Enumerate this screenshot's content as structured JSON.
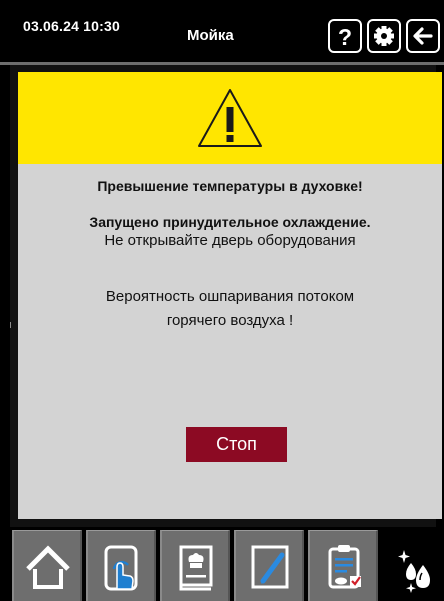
{
  "header": {
    "datetime": "03.06.24  10:30",
    "title": "Мойка",
    "buttons": [
      {
        "icon": "help-icon"
      },
      {
        "icon": "gear-icon"
      },
      {
        "icon": "back-arrow-icon"
      }
    ]
  },
  "alert": {
    "icon": "warning-triangle-icon",
    "header_color": "#ffe600",
    "line1": "Превышение температуры в духовке!",
    "line2": "Запущено принудительное охлаждение.",
    "line3": "Не открывайте дверь оборудования",
    "line4": "Вероятность ошпаривания потоком",
    "line5": "горячего воздуха !",
    "stop_label": "Стоп",
    "stop_color": "#8c0a23"
  },
  "bottom_nav": [
    {
      "icon": "home-icon"
    },
    {
      "icon": "touch-program-icon"
    },
    {
      "icon": "recipe-book-icon"
    },
    {
      "icon": "edit-pencil-icon"
    },
    {
      "icon": "checklist-icon"
    },
    {
      "icon": "cleaning-drops-icon",
      "active": true
    }
  ]
}
